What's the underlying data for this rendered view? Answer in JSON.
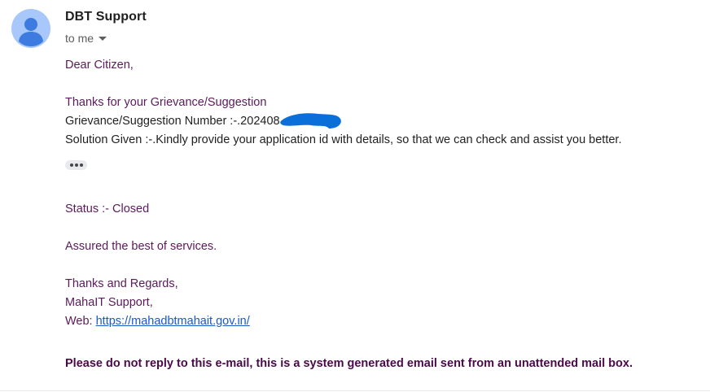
{
  "sender": {
    "name": "DBT Support"
  },
  "recipient": {
    "label": "to me"
  },
  "body": {
    "greeting": "Dear Citizen,",
    "thanks_line": "Thanks for your Grievance/Suggestion",
    "number_prefix": "Grievance/Suggestion Number :-.202408",
    "solution": "Solution Given :-.Kindly provide your application id with details, so that we can check and assist you better.",
    "status": "Status :- Closed",
    "assured": "Assured the best of services.",
    "regards": "Thanks and Regards,",
    "org": "MahaIT Support,",
    "web_label": "Web: ",
    "web_url": "https://mahadbtmahait.gov.in/",
    "warning": "Please do not reply to this e-mail, this is a system generated email sent from an unattended mail box."
  },
  "colors": {
    "body_text": "#5b1a5b",
    "link": "#1a57c9",
    "redaction": "#0a6fd8",
    "avatar_bg": "#a8c7fa",
    "avatar_fg": "#1a73e8"
  }
}
